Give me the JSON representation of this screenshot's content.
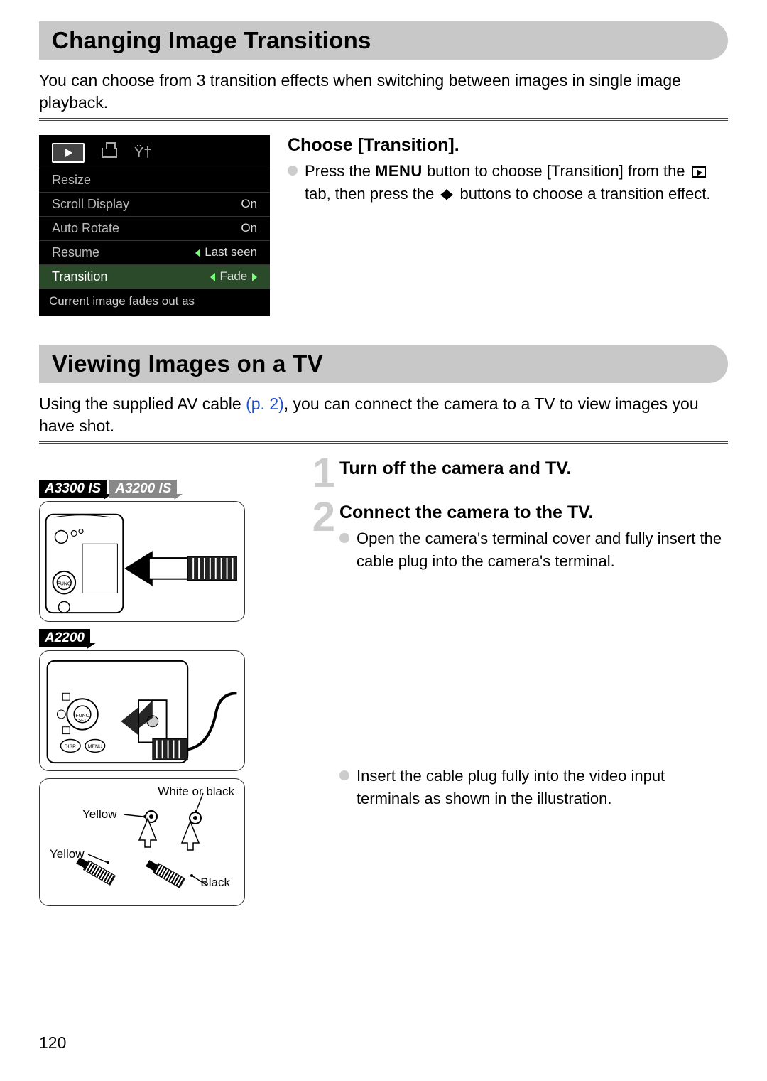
{
  "page_number": "120",
  "section1": {
    "title": "Changing Image Transitions",
    "intro": "You can choose from 3 transition effects when switching between images in single image playback.",
    "menu": {
      "items": [
        {
          "label": "Resize",
          "value": ""
        },
        {
          "label": "Scroll Display",
          "value": "On"
        },
        {
          "label": "Auto Rotate",
          "value": "On"
        },
        {
          "label": "Resume",
          "value": "Last seen"
        },
        {
          "label": "Transition",
          "value": "Fade"
        }
      ],
      "footer": "Current image fades out as"
    },
    "step": {
      "title": "Choose [Transition].",
      "line1a": "Press the ",
      "line1b": " button to choose [Transition] from the ",
      "line1c": " tab, then press the ",
      "line1d": " buttons to choose a transition effect.",
      "menu_word": "MENU"
    }
  },
  "section2": {
    "title": "Viewing Images on a TV",
    "intro_a": "Using the supplied AV cable ",
    "intro_link": "(p. 2)",
    "intro_b": ", you can connect the camera to a TV to view images you have shot.",
    "badges": [
      "A3300 IS",
      "A3200 IS",
      "A2200"
    ],
    "steps": [
      {
        "num": "1",
        "title": "Turn off the camera and TV."
      },
      {
        "num": "2",
        "title": "Connect the camera to the TV.",
        "bullet": "Open the camera's terminal cover and fully insert the cable plug into the camera's terminal."
      }
    ],
    "bullet3": "Insert the cable plug fully into the video input terminals as shown in the illustration.",
    "tv_labels": {
      "white_or_black": "White or black",
      "yellow": "Yellow",
      "black": "Black"
    }
  }
}
